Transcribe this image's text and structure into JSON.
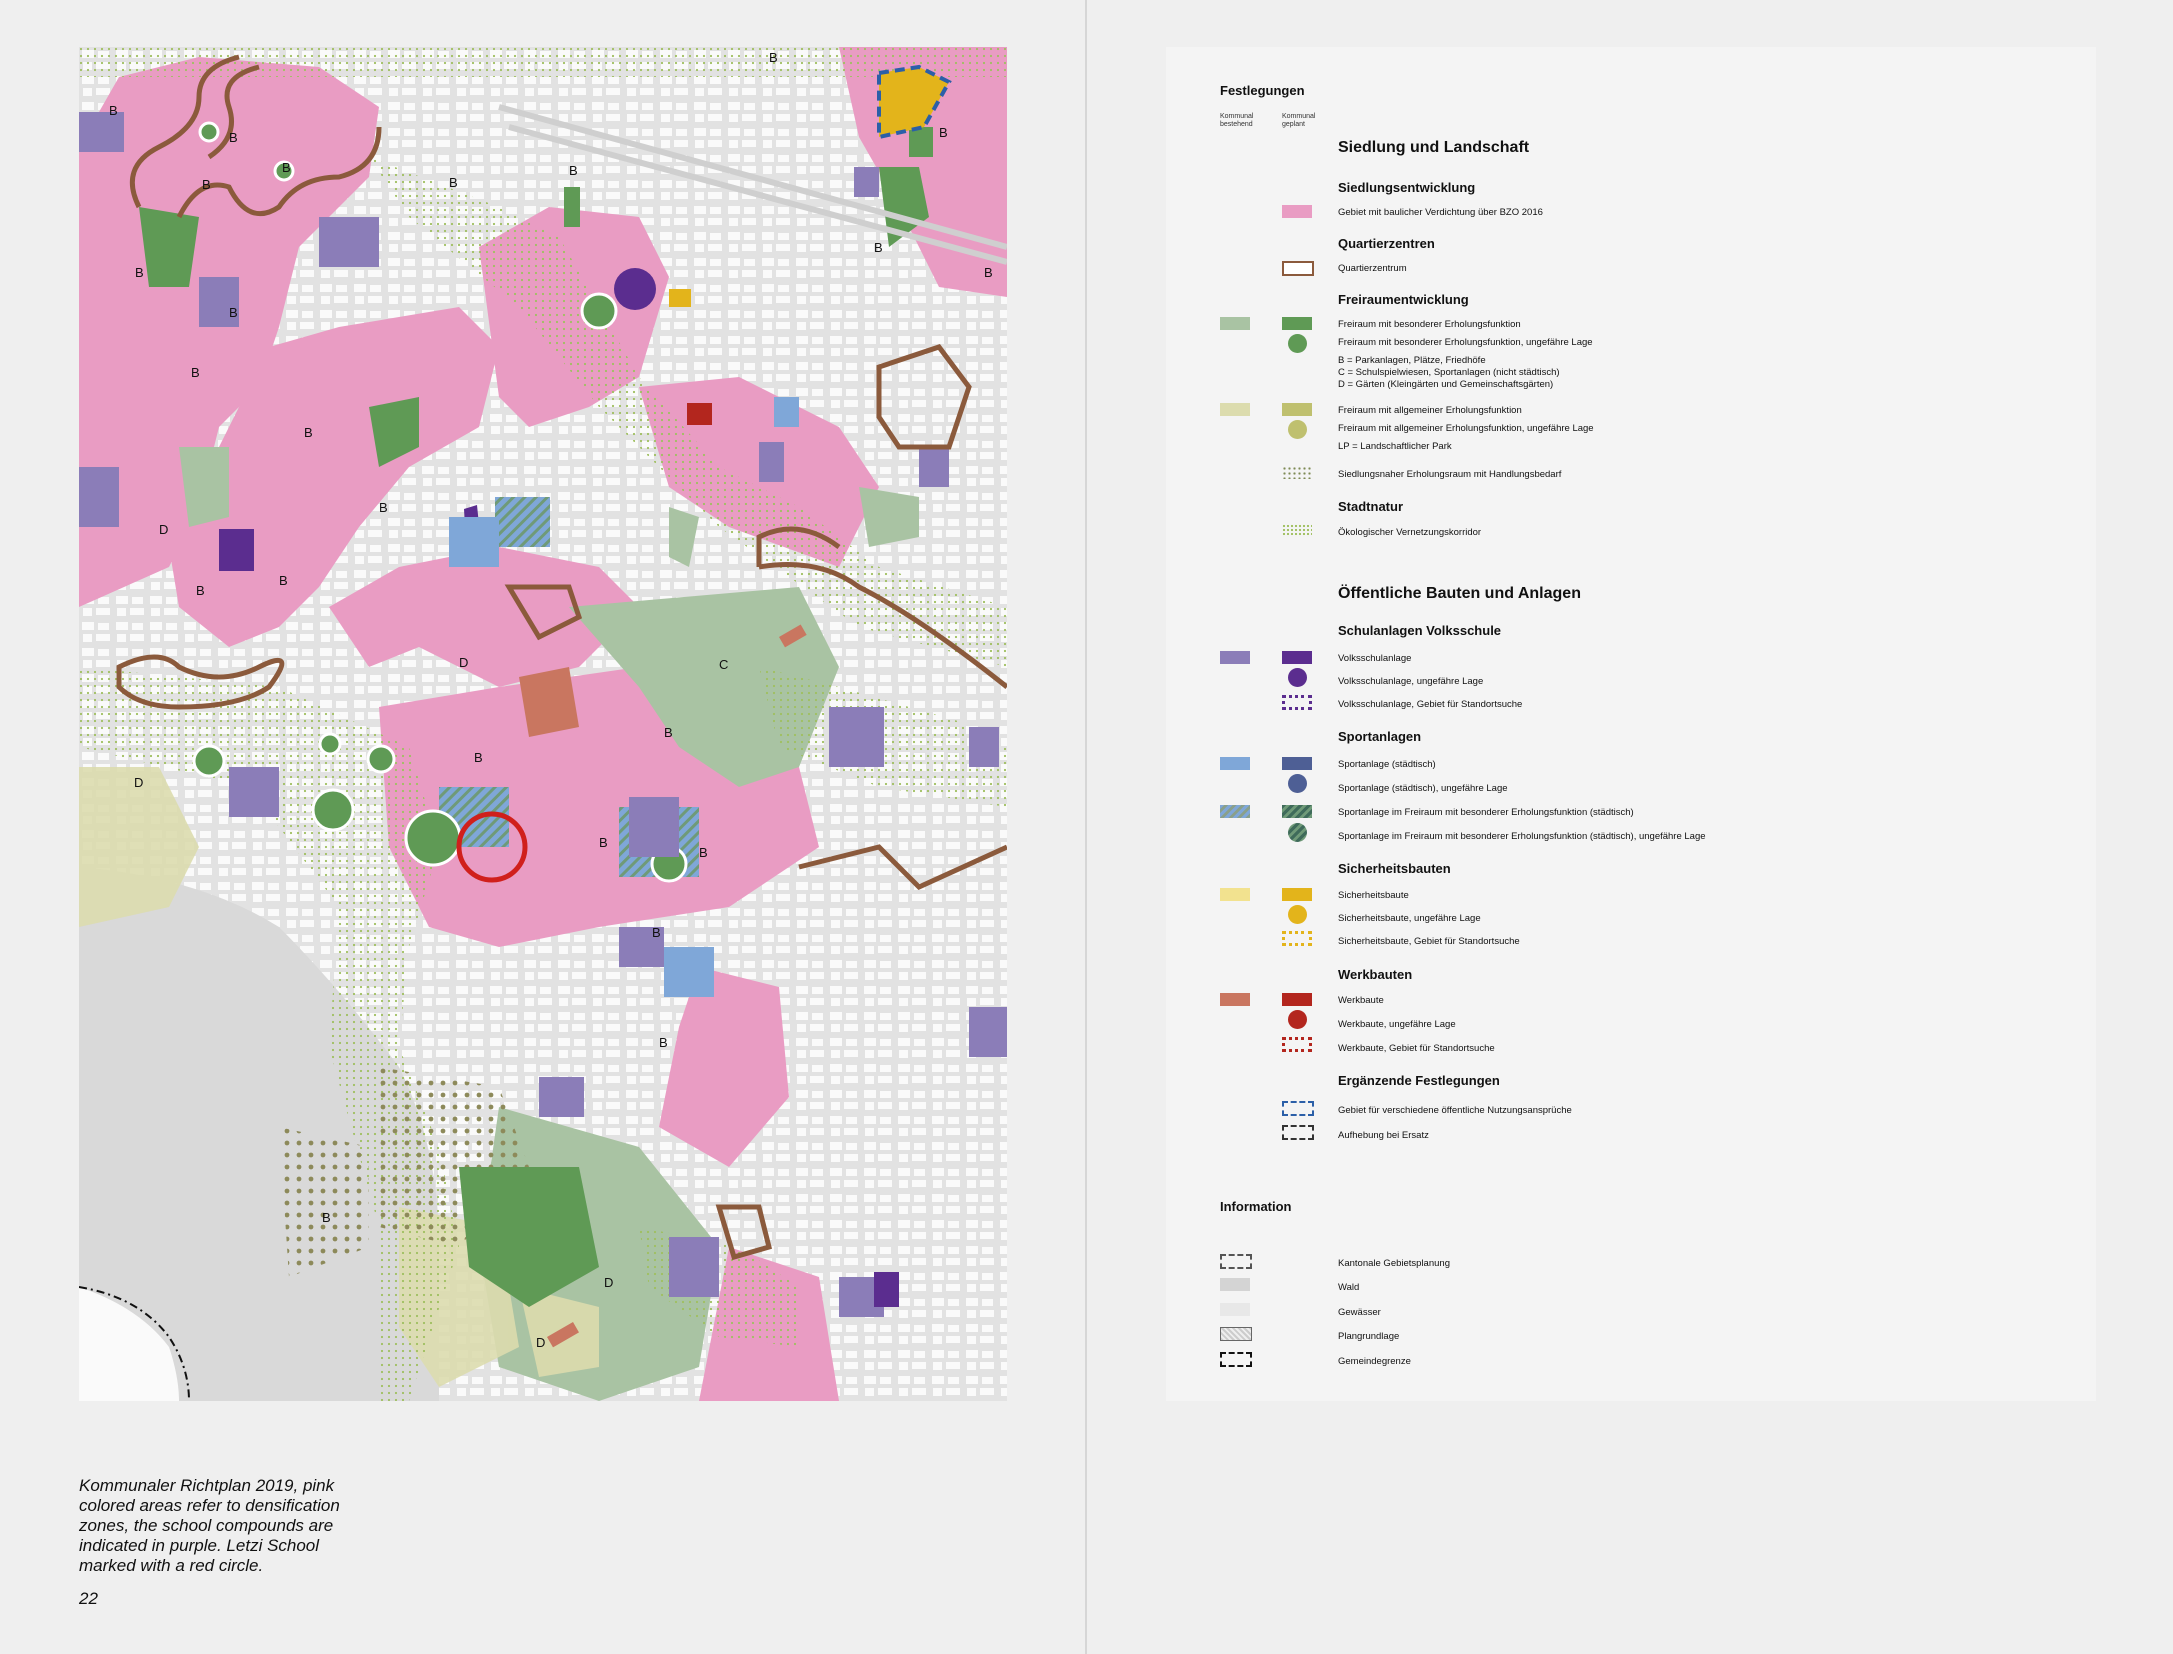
{
  "map": {
    "letters": [
      {
        "t": "B"
      },
      {
        "t": "B"
      },
      {
        "t": "B"
      },
      {
        "t": "B"
      },
      {
        "t": "B"
      },
      {
        "t": "B"
      },
      {
        "t": "B"
      },
      {
        "t": "B"
      },
      {
        "t": "B"
      },
      {
        "t": "B"
      },
      {
        "t": "B"
      },
      {
        "t": "B"
      },
      {
        "t": "B"
      },
      {
        "t": "B"
      },
      {
        "t": "B"
      },
      {
        "t": "B"
      },
      {
        "t": "B"
      },
      {
        "t": "D"
      },
      {
        "t": "D"
      },
      {
        "t": "D"
      },
      {
        "t": "C"
      },
      {
        "t": "B"
      },
      {
        "t": "B"
      },
      {
        "t": "B"
      },
      {
        "t": "B"
      },
      {
        "t": "B"
      },
      {
        "t": "B"
      },
      {
        "t": "D"
      },
      {
        "t": "D"
      },
      {
        "t": "B"
      }
    ]
  },
  "caption": "Kommunaler Richtplan 2019, pink colored areas refer to densification zones, the school compounds are indicated in purple. Letzi School marked with a red circle.",
  "page_number": "22",
  "legend": {
    "title": "Festlegungen",
    "col_existing": "Kommunal bestehend",
    "col_planned": "Kommunal geplant",
    "section1": "Siedlung und Landschaft",
    "siedlung_title": "Siedlungsentwicklung",
    "siedlung_item": "Gebiet mit baulicher Verdichtung über BZO 2016",
    "quartier_title": "Quartierzentren",
    "quartier_item": "Quartierzentrum",
    "frei_title": "Freiraumentwicklung",
    "frei_1": "Freiraum mit besonderer Erholungsfunktion",
    "frei_2": "Freiraum mit besonderer Erholungsfunktion, ungefähre Lage",
    "frei_note_b": "B = Parkanlagen, Plätze, Friedhöfe",
    "frei_note_c": "C = Schulspielwiesen, Sportanlagen (nicht städtisch)",
    "frei_note_d": "D = Gärten (Kleingärten und Gemeinschaftsgärten)",
    "frei_3": "Freiraum mit allgemeiner Erholungsfunktion",
    "frei_4": "Freiraum mit allgemeiner Erholungsfunktion, ungefähre Lage",
    "frei_note_lp": "LP = Landschaftlicher Park",
    "frei_5": "Siedlungsnaher Erholungsraum mit Handlungsbedarf",
    "stadt_title": "Stadtnatur",
    "stadt_item": "Ökologischer Vernetzungskorridor",
    "section2": "Öffentliche Bauten und Anlagen",
    "schul_title": "Schulanlagen Volksschule",
    "schul_1": "Volksschulanlage",
    "schul_2": "Volksschulanlage, ungefähre Lage",
    "schul_3": "Volksschulanlage, Gebiet für Standortsuche",
    "sport_title": "Sportanlagen",
    "sport_1": "Sportanlage (städtisch)",
    "sport_2": "Sportanlage (städtisch), ungefähre Lage",
    "sport_3": "Sportanlage im Freiraum mit besonderer Erholungsfunktion (städtisch)",
    "sport_4": "Sportanlage im Freiraum mit besonderer Erholungsfunktion (städtisch), ungefähre Lage",
    "sicher_title": "Sicherheitsbauten",
    "sicher_1": "Sicherheitsbaute",
    "sicher_2": "Sicherheitsbaute, ungefähre Lage",
    "sicher_3": "Sicherheitsbaute, Gebiet für Standortsuche",
    "werk_title": "Werkbauten",
    "werk_1": "Werkbaute",
    "werk_2": "Werkbaute, ungefähre Lage",
    "werk_3": "Werkbaute, Gebiet für Standortsuche",
    "erg_title": "Ergänzende Festlegungen",
    "erg_1": "Gebiet für verschiedene öffentliche Nutzungsansprüche",
    "erg_2": "Aufhebung bei Ersatz",
    "info_title": "Information",
    "info_1": "Kantonale Gebietsplanung",
    "info_2": "Wald",
    "info_3": "Gewässer",
    "info_4": "Plangrundlage",
    "info_5": "Gemeindegrenze"
  },
  "colors": {
    "pink": "#e99cc3",
    "green_dark": "#5f9a55",
    "green_light": "#a9c3a3",
    "olive": "#bfc06f",
    "olive_light": "#dcdcae",
    "purple": "#5b2d8f",
    "purple_light": "#8b7db8",
    "blue": "#5b83c5",
    "blue_light": "#7fa7d8",
    "yellow": "#e3b41b",
    "yellow_light": "#f2e28f",
    "red": "#b3261e",
    "red_light": "#c97660",
    "brown": "#8b5a3c",
    "highlight_red": "#d0201c"
  }
}
